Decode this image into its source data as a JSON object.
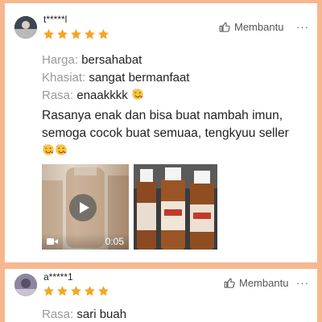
{
  "review1": {
    "username": "t*****l",
    "rating": 5,
    "helpful_label": "Membantu",
    "more_label": "···",
    "attributes": [
      {
        "key": "Harga:",
        "value": "bersahabat"
      },
      {
        "key": "Khasiat:",
        "value": "sangat bermanfaat"
      },
      {
        "key": "Rasa:",
        "value": "enaakkkk"
      }
    ],
    "text_line1": "Rasanya enak dan bisa buat nambah imun,",
    "text_line2": "semoga cocok buat semuaa, tengkyuu seller",
    "media": {
      "video_duration": "0:05"
    }
  },
  "review2": {
    "username": "a*****1",
    "rating": 5,
    "helpful_label": "Membantu",
    "more_label": "···",
    "attributes": [
      {
        "key": "Rasa:",
        "value": "sari buah"
      }
    ]
  },
  "colors": {
    "background": "#f7b78e",
    "star": "#f5a623",
    "card": "#ffffff"
  },
  "icons": {
    "emoji": "smiling-face-with-hearts",
    "helpful": "thumbs-up-icon",
    "play": "play-icon",
    "video": "video-camera-icon"
  }
}
